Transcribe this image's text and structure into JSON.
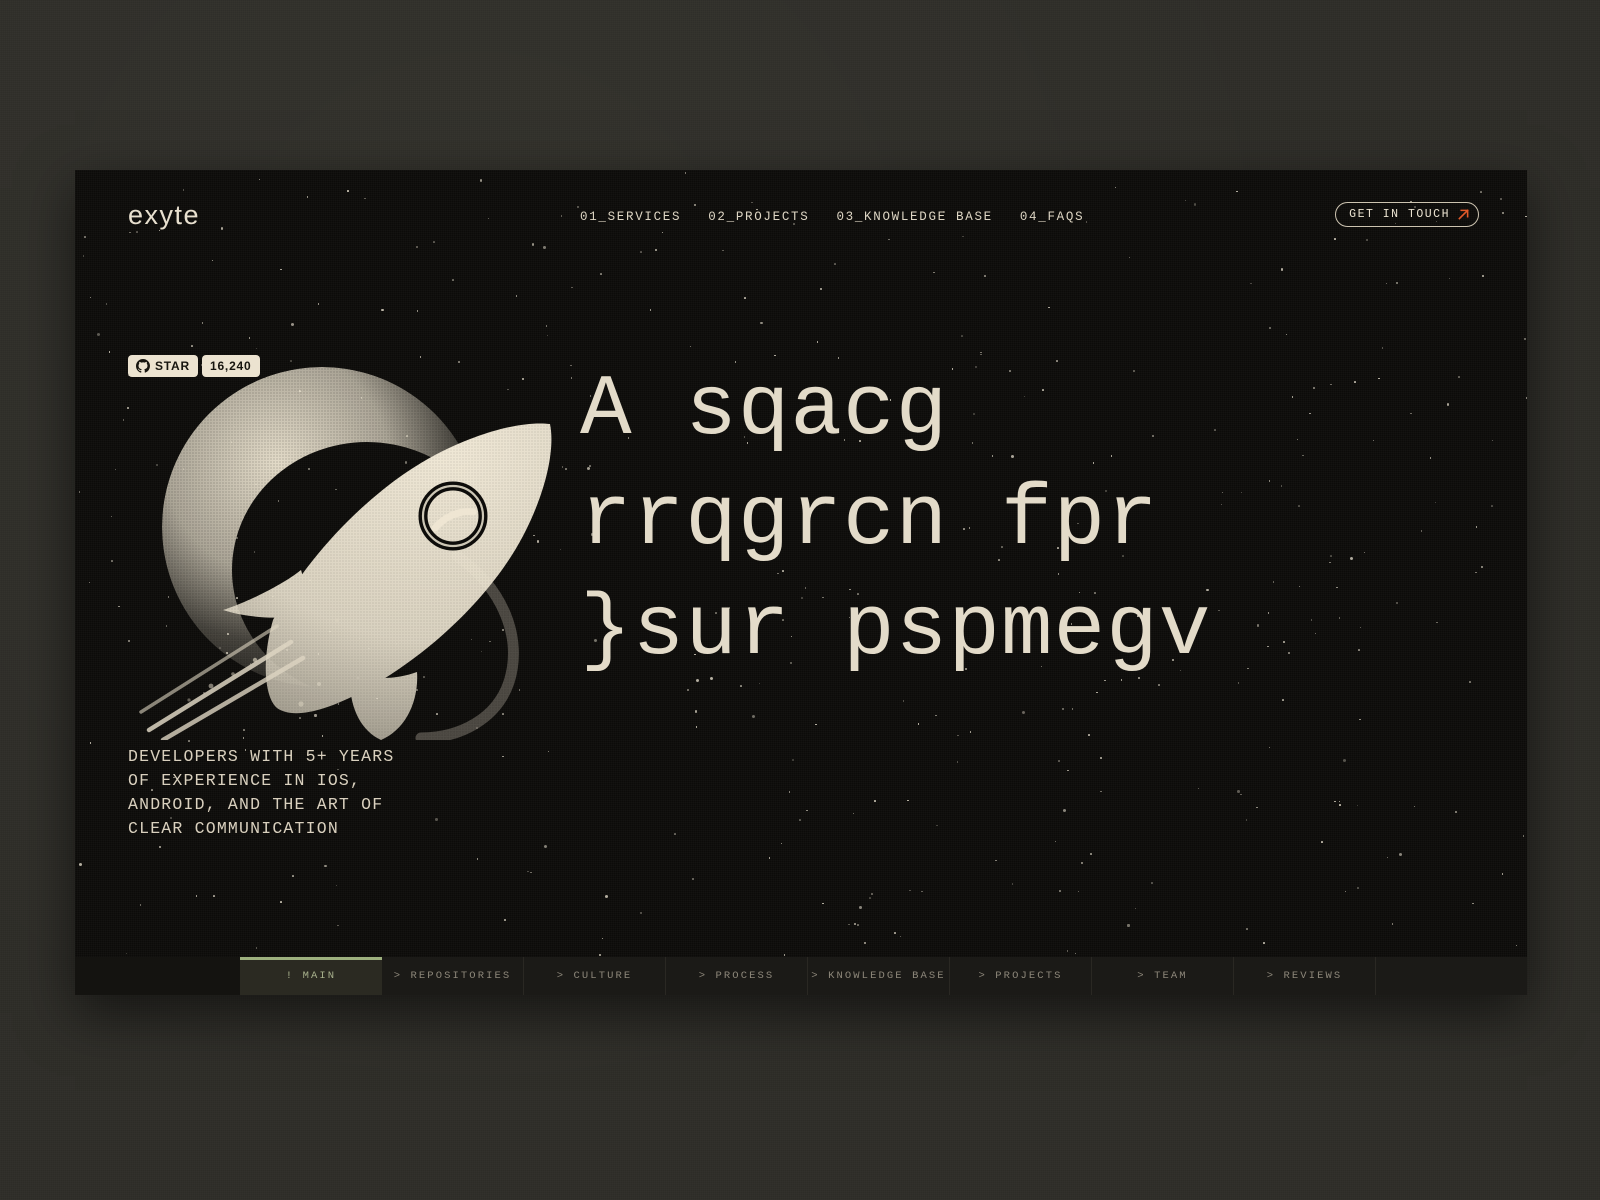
{
  "brand": {
    "logo": "exyte"
  },
  "nav": {
    "items": [
      {
        "label": "01_SERVICES"
      },
      {
        "label": "02_PROJECTS"
      },
      {
        "label": "03_KNOWLEDGE BASE"
      },
      {
        "label": "04_FAQS"
      }
    ],
    "cta_label": "GET IN TOUCH",
    "cta_icon": "arrow-up-right-icon"
  },
  "github": {
    "icon": "github-icon",
    "star_label": "STAR",
    "star_count": "16,240"
  },
  "hero": {
    "headline_line1": "A sqacg",
    "headline_line2": "rrqgrcn fpr",
    "headline_line3": "}sur pspmegv",
    "sub_line1": "DEVELOPERS WITH 5+ YEARS",
    "sub_line2": "OF EXPERIENCE IN IOS,",
    "sub_line3": "ANDROID, AND THE ART OF",
    "sub_line4": "CLEAR COMMUNICATION",
    "artwork": "rocket-moon-illustration"
  },
  "tabbar": {
    "tabs": [
      {
        "label": "! MAIN",
        "active": true
      },
      {
        "label": "> REPOSITORIES",
        "active": false
      },
      {
        "label": "> CULTURE",
        "active": false
      },
      {
        "label": "> PROCESS",
        "active": false
      },
      {
        "label": "> KNOWLEDGE BASE",
        "active": false
      },
      {
        "label": "> PROJECTS",
        "active": false
      },
      {
        "label": "> TEAM",
        "active": false
      },
      {
        "label": "> REVIEWS",
        "active": false
      }
    ]
  },
  "colors": {
    "desk_background": "#2e2d27",
    "page_background": "#0d0c0a",
    "text_cream": "#e3dbc9",
    "accent_orange": "#e0592a",
    "accent_green": "#9db07e",
    "tab_background": "#1b1a17",
    "tab_active_background": "#2b2a22"
  }
}
